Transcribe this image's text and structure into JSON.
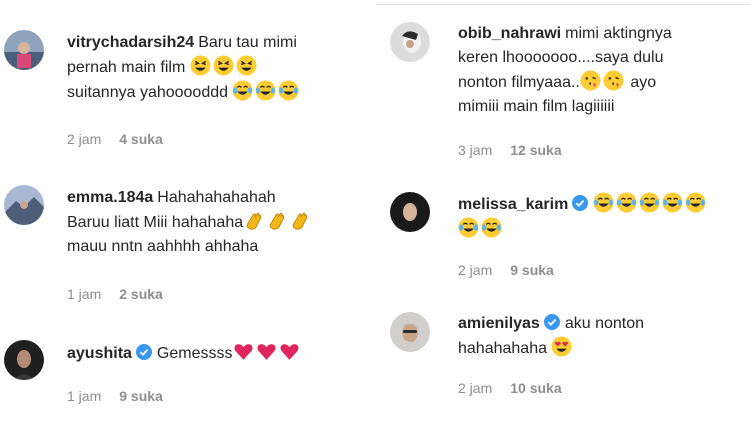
{
  "left_column": [
    {
      "username": "vitrychadarsih24",
      "verified": false,
      "lines": [
        "Baru tau mimi",
        "pernah main film",
        "suitannya yahooooddd"
      ],
      "time": "2 jam",
      "likes": "4 suka",
      "avatar_color": "#5a6f8f"
    },
    {
      "username": "emma.184a",
      "verified": false,
      "lines": [
        "Hahahahahahah",
        "Baruu liatt Miii hahahaha",
        "mauu nntn aahhhh ahhaha"
      ],
      "time": "1 jam",
      "likes": "2 suka",
      "avatar_color": "#6b7fa8"
    },
    {
      "username": "ayushita",
      "verified": true,
      "lines": [
        "Gemessss"
      ],
      "time": "1 jam",
      "likes": "9 suka",
      "avatar_color": "#2a2a2a"
    }
  ],
  "right_column": [
    {
      "username": "obib_nahrawi",
      "verified": false,
      "lines": [
        "mimi aktingnya",
        "keren lhooooooo....saya dulu",
        "nonton filmyaaa..",
        "mimiii main film lagiiiiii"
      ],
      "line3_suffix": "ayo",
      "time": "3 jam",
      "likes": "12 suka",
      "avatar_color": "#c9c9c9"
    },
    {
      "username": "melissa_karim",
      "verified": true,
      "lines": [
        ""
      ],
      "time": "2 jam",
      "likes": "9 suka",
      "avatar_color": "#1f1f1f"
    },
    {
      "username": "amienilyas",
      "verified": true,
      "lines": [
        "aku nonton",
        "hahahahaha"
      ],
      "time": "2 jam",
      "likes": "10 suka",
      "avatar_color": "#b7b7b7"
    }
  ],
  "colors": {
    "text": "#262626",
    "meta": "#8e8e8e",
    "verified_badge": "#3897f0",
    "heart": "#e0245e",
    "emoji_face": "#ffcc33"
  }
}
